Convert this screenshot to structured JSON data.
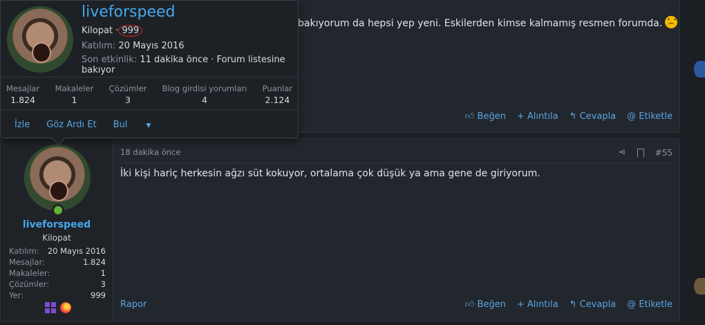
{
  "post54": {
    "body_text": "bakıyorum da hepsi yep yeni. Eskilerden kimse kalmamış resmen forumda.",
    "actions": [
      "Beğen",
      "Alıntıla",
      "Cevapla",
      "Etiketle"
    ]
  },
  "post55": {
    "time": "18 dakika önce",
    "number": "#55",
    "body_text": "İki kişi hariç herkesin ağzı süt kokuyor, ortalama çok düşük ya ama gene de giriyorum.",
    "report": "Rapor",
    "actions": [
      "Beğen",
      "Alıntıla",
      "Cevapla",
      "Etiketle"
    ],
    "user": {
      "name": "liveforspeed",
      "title": "Kilopat",
      "stats": [
        {
          "label": "Katılım:",
          "value": "20 Mayıs 2016"
        },
        {
          "label": "Mesajlar:",
          "value": "1.824"
        },
        {
          "label": "Makaleler:",
          "value": "1"
        },
        {
          "label": "Çözümler:",
          "value": "3"
        },
        {
          "label": "Yer:",
          "value": "999"
        }
      ]
    }
  },
  "tooltip": {
    "name": "liveforspeed",
    "title": "Kilopat",
    "separator": "·",
    "location": "999",
    "joined_label": "Katılım:",
    "joined_value": "20 Mayıs 2016",
    "activity_label": "Son etkinlik:",
    "activity_value": "11 dakika önce · Forum listesine bakıyor",
    "stats": [
      {
        "label": "Mesajlar",
        "value": "1.824"
      },
      {
        "label": "Makaleler",
        "value": "1"
      },
      {
        "label": "Çözümler",
        "value": "3"
      },
      {
        "label": "Blog girdisi yorumları",
        "value": "4"
      },
      {
        "label": "Puanlar",
        "value": "2.124"
      }
    ],
    "actions": [
      "İzle",
      "Göz Ardı Et",
      "Bul"
    ]
  },
  "colors": {
    "accent": "#47a7eb",
    "link": "#5aa4e3",
    "online": "#63b132",
    "annotation": "#dd2222"
  }
}
